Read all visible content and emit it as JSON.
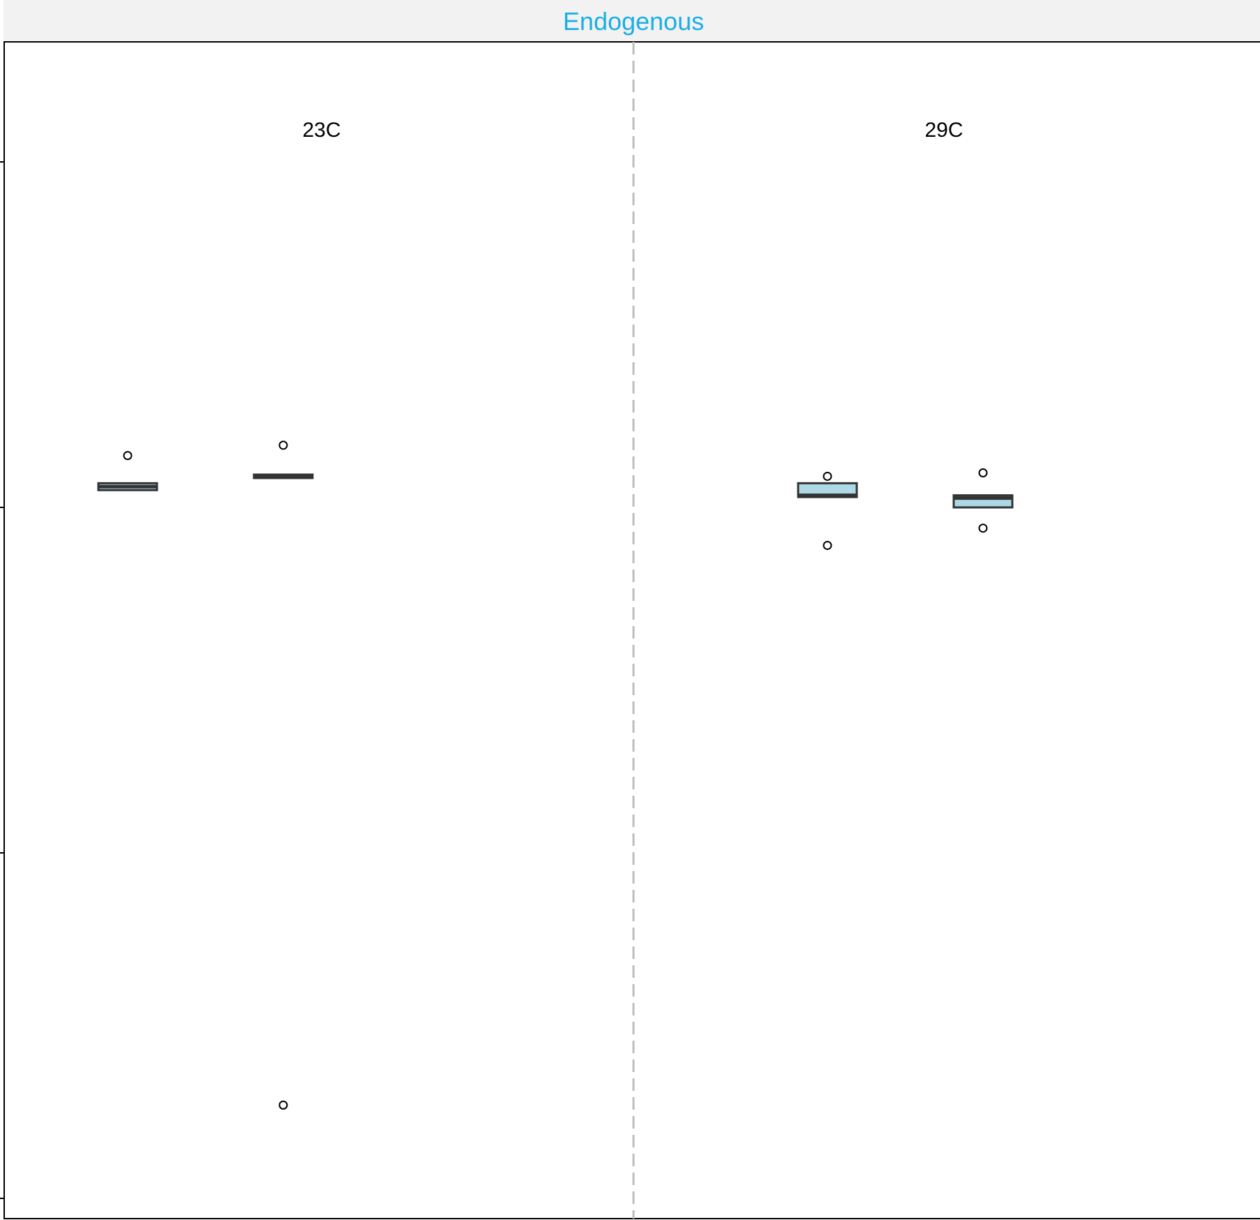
{
  "chart_data": {
    "type": "box",
    "facet_title": "Endogenous",
    "facet_title_color": "#1aaee6",
    "strip_background": "#f2f2f2",
    "box_fill": "#add8e6",
    "box_line": "#333333",
    "divider_color": "#bdbdbd",
    "ylim": [
      0,
      4.25
    ],
    "panels": [
      {
        "label": "23C",
        "boxes": [
          {
            "q1": 2.05,
            "median": 2.06,
            "q3": 2.07,
            "outliers": [
              2.15
            ]
          },
          {
            "q1": 2.085,
            "median": 2.09,
            "q3": 2.095,
            "outliers": [
              2.18,
              0.27
            ]
          }
        ]
      },
      {
        "label": "29C",
        "boxes": [
          {
            "q1": 2.03,
            "median": 2.035,
            "q3": 2.07,
            "outliers": [
              2.09,
              1.89
            ]
          },
          {
            "q1": 2.0,
            "median": 2.027,
            "q3": 2.035,
            "outliers": [
              2.1,
              1.94
            ]
          }
        ]
      }
    ]
  }
}
